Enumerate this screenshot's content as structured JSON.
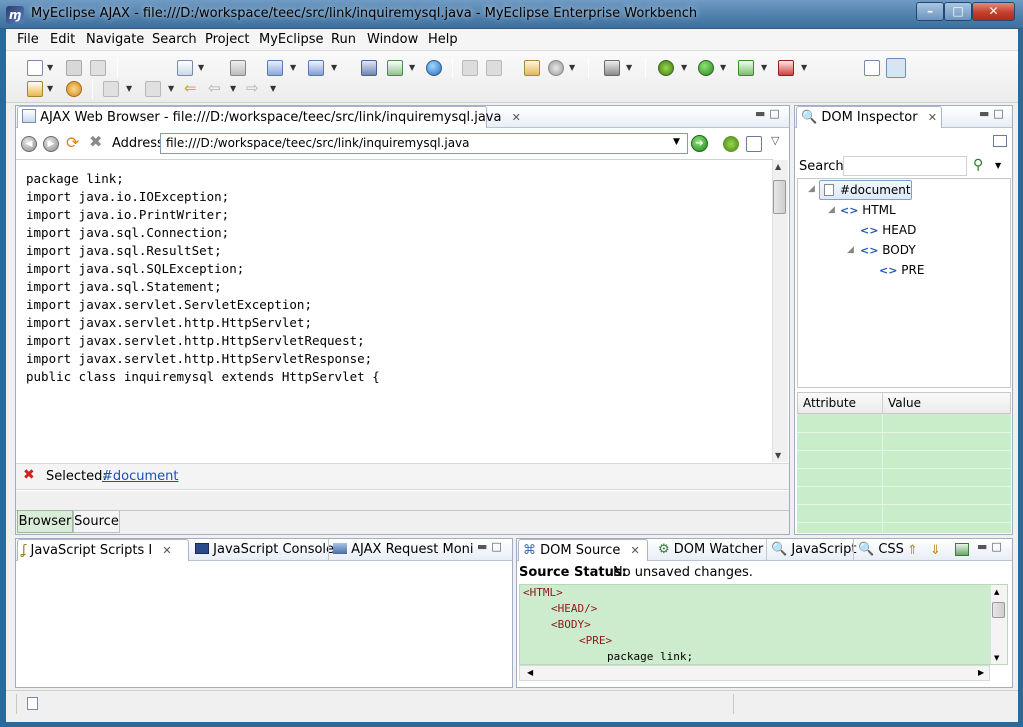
{
  "window": {
    "title": "MyEclipse AJAX - file:///D:/workspace/teec/src/link/inquiremysql.java - MyEclipse Enterprise Workbench",
    "min": "–",
    "max": "□",
    "close": "✕"
  },
  "menu": [
    "File",
    "Edit",
    "Navigate",
    "Search",
    "Project",
    "MyEclipse",
    "Run",
    "Window",
    "Help"
  ],
  "browser": {
    "tab_label": "AJAX Web Browser - file:///D:/workspace/teec/src/link/inquiremysql.java",
    "address_label": "Address",
    "address_value": "file:///D:/workspace/teec/src/link/inquiremysql.java",
    "code": [
      "package link;",
      "",
      "import java.io.IOException;",
      "import java.io.PrintWriter;",
      "import java.sql.Connection;",
      "import java.sql.ResultSet;",
      "import java.sql.SQLException;",
      "import java.sql.Statement;",
      "",
      "import javax.servlet.ServletException;",
      "import javax.servlet.http.HttpServlet;",
      "import javax.servlet.http.HttpServletRequest;",
      "import javax.servlet.http.HttpServletResponse;",
      "",
      "public class inquiremysql extends HttpServlet {"
    ],
    "selected_label": "Selected:",
    "selected_value": "#document",
    "bottom_tabs": [
      "Browser",
      "Source"
    ]
  },
  "dom_inspector": {
    "tab_label": "DOM Inspector",
    "search_label": "Search:",
    "tree": [
      "#document",
      "HTML",
      "HEAD",
      "BODY",
      "PRE"
    ],
    "attr_header": "Attribute",
    "value_header": "Value"
  },
  "bottom_left": {
    "tabs": [
      "JavaScript Scripts I",
      "JavaScript Console",
      "AJAX Request Moni"
    ]
  },
  "bottom_right": {
    "tabs": [
      "DOM Source",
      "DOM Watcher",
      "JavaScript",
      "CSS"
    ],
    "status_label": "Source Status:",
    "status_value": "No unsaved changes.",
    "source_lines": {
      "l1": "<HTML>",
      "l2": "<HEAD/>",
      "l3": "<BODY>",
      "l4": "<PRE>",
      "l5": "package link;"
    }
  },
  "colors": {
    "title_bar": "#4e7eaa",
    "inspector_grid": "#c9ecc9",
    "source_bg": "#cdeccd",
    "link": "#1a4fb8",
    "error_icon": "#d02020"
  }
}
